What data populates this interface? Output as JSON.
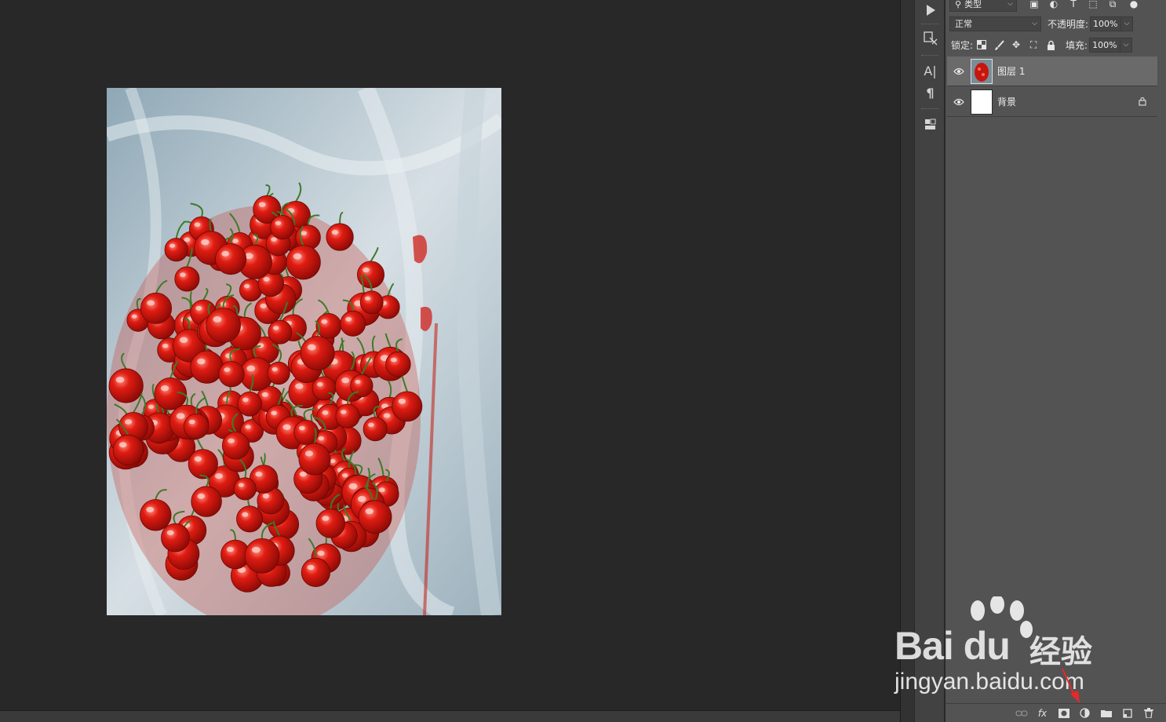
{
  "canvas": {
    "image": "cherries-photo"
  },
  "tools": [
    {
      "icon": "play-icon"
    },
    {
      "icon": "brush-preset-icon"
    },
    {
      "icon": "character-icon",
      "glyph": "A|"
    },
    {
      "icon": "paragraph-icon",
      "glyph": "¶"
    },
    {
      "icon": "3d-icon"
    }
  ],
  "layers_panel": {
    "filter": {
      "kind_label": "类型"
    },
    "blend_mode": "正常",
    "opacity_label": "不透明度:",
    "opacity_value": "100%",
    "lock_label": "锁定:",
    "fill_label": "填充:",
    "fill_value": "100%",
    "layers": [
      {
        "name": "图层 1",
        "selected": true,
        "visible": true,
        "thumb": "cherries",
        "locked": false
      },
      {
        "name": "背景",
        "selected": false,
        "visible": true,
        "thumb": "white",
        "locked": true
      }
    ],
    "footer_icons": [
      "link-layers-icon",
      "fx-icon",
      "add-mask-icon",
      "adjustment-layer-icon",
      "new-group-icon",
      "new-layer-icon",
      "delete-icon"
    ]
  },
  "watermark": {
    "brand": "Bai du",
    "suffix": "经验",
    "url": "jingyan.baidu.com"
  },
  "colors": {
    "canvas_bg": "#282828",
    "panel_bg": "#535353",
    "selected_layer": "#6a6a6a",
    "annotation_arrow": "#e8282a"
  }
}
